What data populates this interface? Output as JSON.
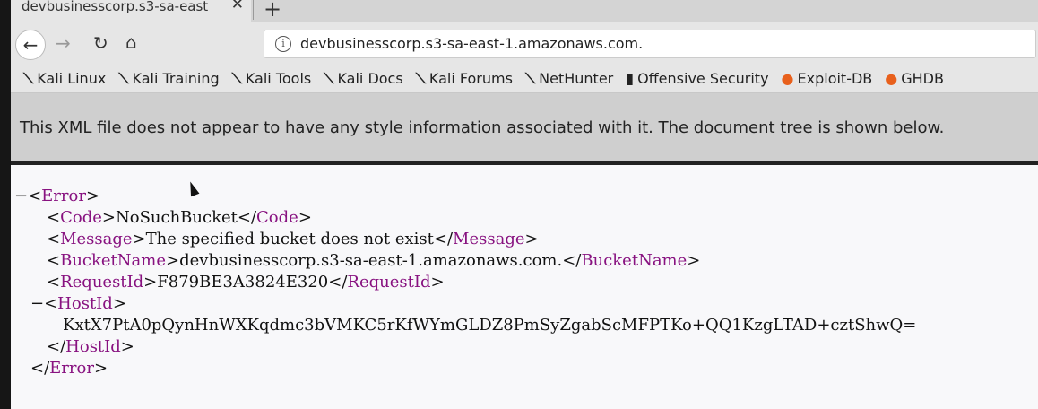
{
  "tab": {
    "title": "devbusinesscorp.s3-sa-east",
    "close": "✕",
    "new_tab": "+"
  },
  "nav": {
    "back": "←",
    "forward": "→",
    "reload": "↻",
    "home": "⌂",
    "url": "devbusinesscorp.s3-sa-east-1.amazonaws.com."
  },
  "bookmarks": [
    "Kali Linux",
    "Kali Training",
    "Kali Tools",
    "Kali Docs",
    "Kali Forums",
    "NetHunter",
    "Offensive Security",
    "Exploit-DB",
    "GHDB"
  ],
  "banner": "This XML file does not appear to have any style information associated with it. The document tree is shown below.",
  "xml": {
    "root": "Error",
    "code_tag": "Code",
    "code": "NoSuchBucket",
    "message_tag": "Message",
    "message": "The specified bucket does not exist",
    "bucket_tag": "BucketName",
    "bucket": "devbusinesscorp.s3-sa-east-1.amazonaws.com.",
    "request_tag": "RequestId",
    "request": "F879BE3A3824E320",
    "host_tag": "HostId",
    "host": "KxtX7PtA0pQynHnWXKqdmc3bVMKC5rKfWYmGLDZ8PmSyZgabScMFPTKo+QQ1KzgLTAD+cztShwQ="
  }
}
